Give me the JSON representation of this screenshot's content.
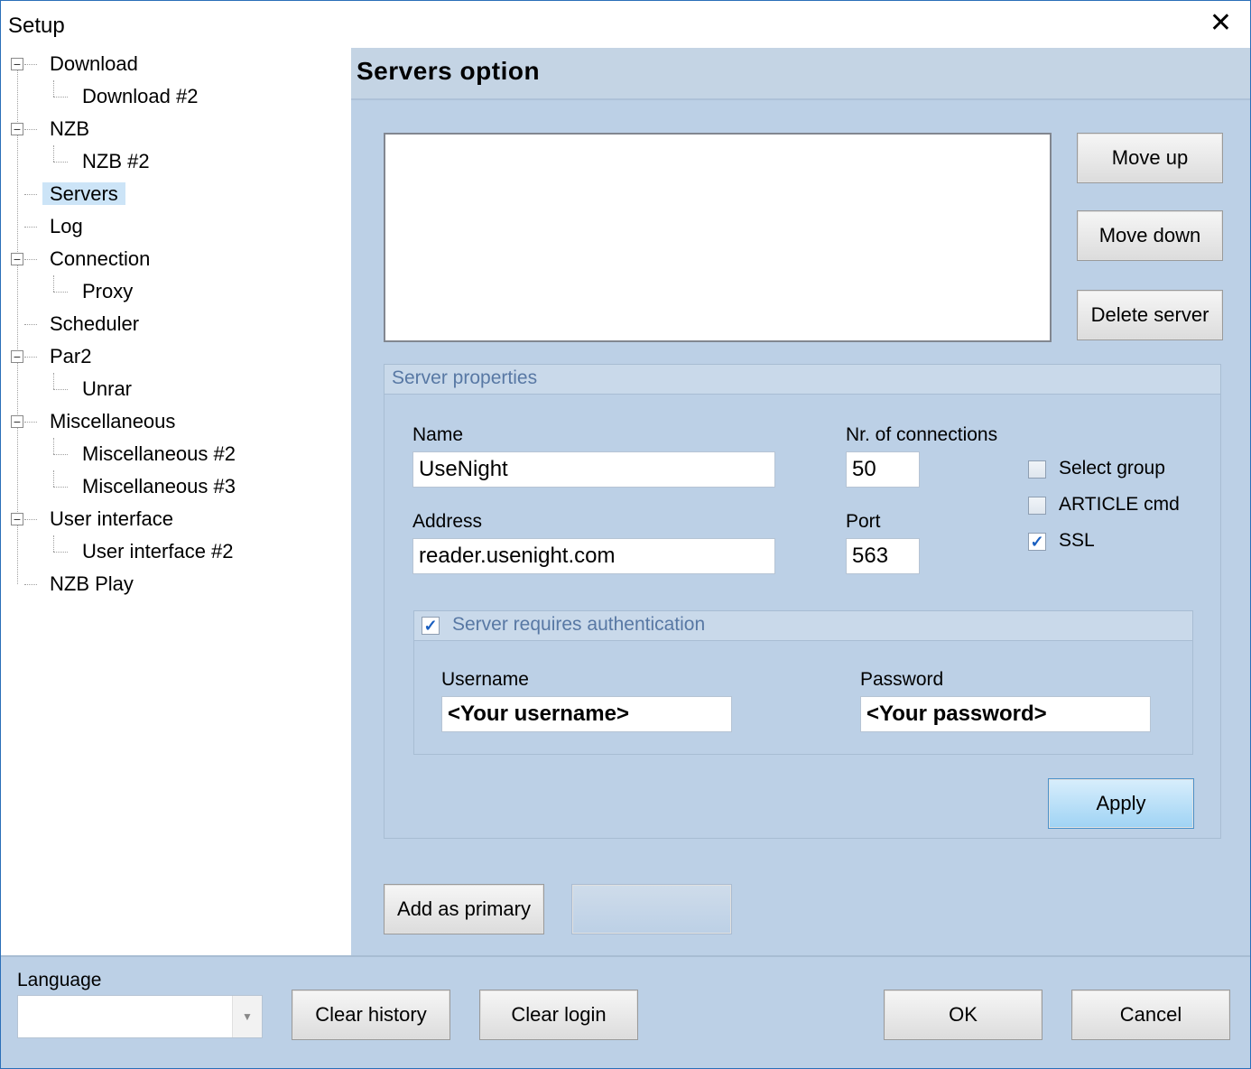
{
  "window": {
    "title": "Setup",
    "close_glyph": "✕"
  },
  "tree": {
    "items": [
      {
        "label": "Download",
        "level": 0,
        "expanded": true
      },
      {
        "label": "Download #2",
        "level": 1
      },
      {
        "label": "NZB",
        "level": 0,
        "expanded": true
      },
      {
        "label": "NZB #2",
        "level": 1
      },
      {
        "label": "Servers",
        "level": 0,
        "selected": true
      },
      {
        "label": "Log",
        "level": 0
      },
      {
        "label": "Connection",
        "level": 0,
        "expanded": true
      },
      {
        "label": "Proxy",
        "level": 1
      },
      {
        "label": "Scheduler",
        "level": 0
      },
      {
        "label": "Par2",
        "level": 0,
        "expanded": true
      },
      {
        "label": "Unrar",
        "level": 1
      },
      {
        "label": "Miscellaneous",
        "level": 0,
        "expanded": true
      },
      {
        "label": "Miscellaneous #2",
        "level": 1
      },
      {
        "label": "Miscellaneous #3",
        "level": 1
      },
      {
        "label": "User interface",
        "level": 0,
        "expanded": true
      },
      {
        "label": "User interface #2",
        "level": 1
      },
      {
        "label": "NZB Play",
        "level": 0
      }
    ]
  },
  "panel": {
    "title": "Servers option",
    "buttons": {
      "move_up": "Move up",
      "move_down": "Move down",
      "delete_server": "Delete server"
    },
    "server_properties": {
      "title": "Server properties",
      "name_label": "Name",
      "name_value": "UseNight",
      "connections_label": "Nr. of connections",
      "connections_value": "50",
      "address_label": "Address",
      "address_value": "reader.usenight.com",
      "port_label": "Port",
      "port_value": "563",
      "select_group": {
        "label": "Select group",
        "checked": false
      },
      "article_cmd": {
        "label": "ARTICLE cmd",
        "checked": false
      },
      "ssl": {
        "label": "SSL",
        "checked": true
      },
      "auth": {
        "title": "Server requires authentication",
        "checked": true,
        "username_label": "Username",
        "username_value": "<Your username>",
        "password_label": "Password",
        "password_value": "<Your password>"
      },
      "apply_label": "Apply"
    },
    "add_primary_label": "Add as primary",
    "add_secondary_label": ""
  },
  "footer": {
    "language_label": "Language",
    "language_value": "",
    "clear_history_label": "Clear history",
    "clear_login_label": "Clear login",
    "ok_label": "OK",
    "cancel_label": "Cancel"
  },
  "check_glyph": "✓",
  "colors": {
    "panel_bg": "#bcd0e6",
    "selected_tree_bg": "#cce4f7",
    "apply_bg": "#9fd3f4"
  }
}
